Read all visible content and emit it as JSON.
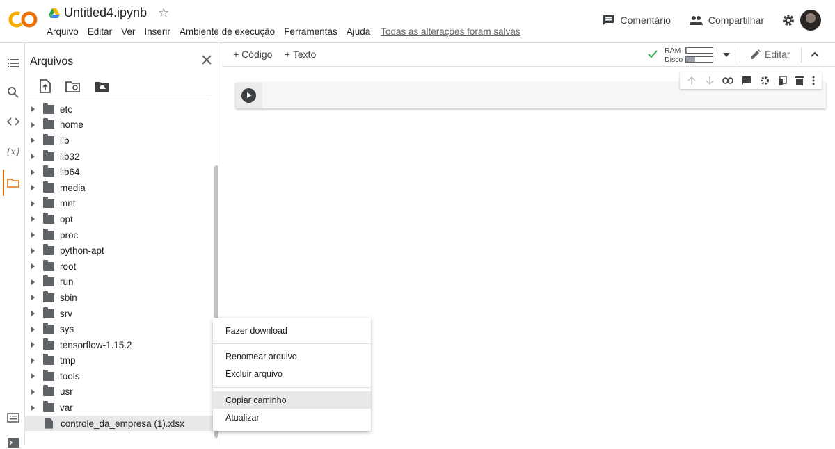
{
  "app": {
    "logo_text": "CO",
    "notebook_title": "Untitled4.ipynb",
    "menu": [
      "Arquivo",
      "Editar",
      "Ver",
      "Inserir",
      "Ambiente de execução",
      "Ferramentas",
      "Ajuda"
    ],
    "save_status": "Todas as alterações foram salvas",
    "comment_label": "Comentário",
    "share_label": "Compartilhar"
  },
  "files_panel": {
    "title": "Arquivos",
    "folders": [
      "etc",
      "home",
      "lib",
      "lib32",
      "lib64",
      "media",
      "mnt",
      "opt",
      "proc",
      "python-apt",
      "root",
      "run",
      "sbin",
      "srv",
      "sys",
      "tensorflow-1.15.2",
      "tmp",
      "tools",
      "usr",
      "var"
    ],
    "selected_file": "controle_da_empresa (1).xlsx"
  },
  "toolbar": {
    "add_code": "+ Código",
    "add_text": "+ Texto",
    "ram_label": "RAM",
    "disk_label": "Disco",
    "ram_usage": 0.05,
    "disk_usage": 0.35,
    "edit_label": "Editar"
  },
  "context_menu": {
    "items": [
      "Fazer download",
      "Renomear arquivo",
      "Excluir arquivo",
      "Copiar caminho",
      "Atualizar"
    ],
    "highlighted": "Copiar caminho"
  },
  "colors": {
    "accent_orange": "#e8710a",
    "logo_yellow": "#f9ab00",
    "check_green": "#34a853"
  }
}
